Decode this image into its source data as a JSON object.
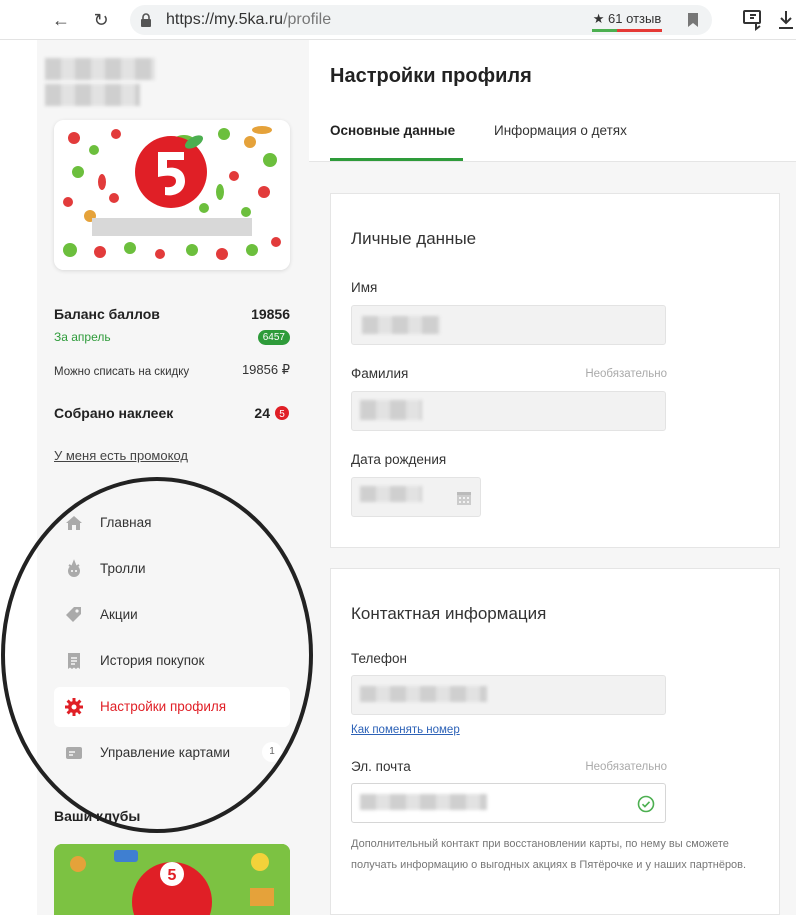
{
  "browser": {
    "url_base": "https://my.5ka.ru",
    "url_path": "/profile",
    "reviews": "61 отзыв"
  },
  "sidebar": {
    "balance_label": "Баланс баллов",
    "balance_value": "19856",
    "period_label": "За апрель",
    "period_badge": "6457",
    "discount_label": "Можно списать на скидку",
    "discount_value": "19856 ₽",
    "stickers_label": "Собрано наклеек",
    "stickers_value": "24",
    "promo_link": "У меня есть промокод",
    "menu": [
      {
        "label": "Главная",
        "icon": "home-icon"
      },
      {
        "label": "Тролли",
        "icon": "troll-icon"
      },
      {
        "label": "Акции",
        "icon": "tag-icon"
      },
      {
        "label": "История покупок",
        "icon": "receipt-icon"
      },
      {
        "label": "Настройки профиля",
        "icon": "gear-icon",
        "active": true
      },
      {
        "label": "Управление картами",
        "icon": "card-icon",
        "badge": "1"
      }
    ],
    "clubs_title": "Ваши клубы"
  },
  "main": {
    "title": "Настройки профиля",
    "tabs": [
      "Основные данные",
      "Информация о детях"
    ],
    "personal": {
      "title": "Личные данные",
      "name_label": "Имя",
      "surname_label": "Фамилия",
      "optional": "Необязательно",
      "birth_label": "Дата рождения"
    },
    "contact": {
      "title": "Контактная информация",
      "phone_label": "Телефон",
      "change_link": "Как поменять номер",
      "email_label": "Эл. почта",
      "optional": "Необязательно",
      "note": "Дополнительный контакт при восстановлении карты, по нему вы сможете получать информацию о выгодных акциях в Пятёрочке и у наших партнёров."
    }
  },
  "colors": {
    "accent_green": "#2e9b3a",
    "brand_red": "#e01f26",
    "link_blue": "#2d62b7"
  }
}
